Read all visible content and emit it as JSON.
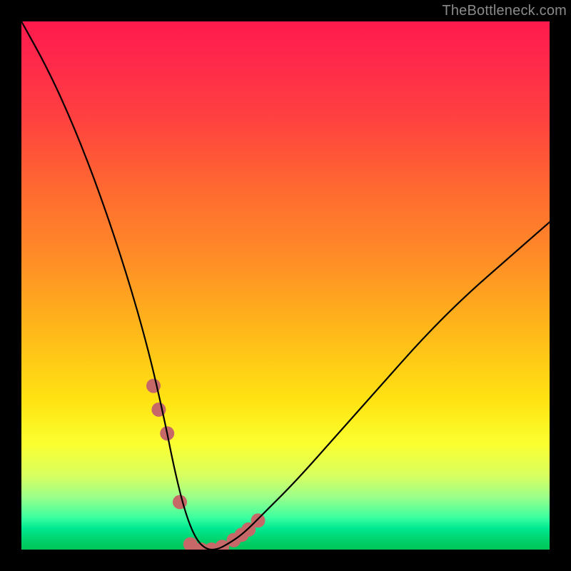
{
  "watermark": "TheBottleneck.com",
  "chart_data": {
    "type": "line",
    "title": "",
    "xlabel": "",
    "ylabel": "",
    "ylim": [
      0,
      100
    ],
    "xlim": [
      0,
      100
    ],
    "series": [
      {
        "name": "curve",
        "x": [
          0,
          5,
          10,
          15,
          20,
          24,
          27,
          29,
          31,
          33,
          35,
          37,
          39,
          42,
          46,
          52,
          60,
          68,
          76,
          84,
          92,
          100
        ],
        "values": [
          100,
          91,
          80,
          67,
          52,
          38,
          25,
          15,
          7,
          2,
          0,
          0,
          1,
          3,
          7,
          13,
          22,
          31,
          40,
          48,
          55,
          62
        ]
      }
    ],
    "markers": {
      "x": [
        25.0,
        26.0,
        27.6,
        30.0,
        32.0,
        34.0,
        36.0,
        38.0,
        40.2,
        41.7,
        43.0,
        44.8
      ],
      "values": [
        31.0,
        26.5,
        22.0,
        9.0,
        1.0,
        0.0,
        0.0,
        0.5,
        1.8,
        2.8,
        3.8,
        5.5
      ],
      "color_hex": "#c76868",
      "radius_px": 10
    },
    "stroke_curve": "#000000",
    "gradient_top": "#ff1a4d",
    "gradient_bottom": "#00c457"
  }
}
